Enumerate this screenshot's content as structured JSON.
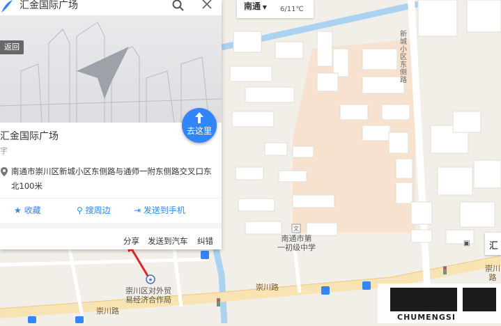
{
  "search": {
    "query": "汇金国际广场"
  },
  "photo": {
    "back_label": "返回"
  },
  "poi": {
    "goto_label": "去这里",
    "name": "汇金国际广场",
    "type": "宇",
    "address_line1": "南通市崇川区新城小区东侧路与通师一附东侧路交叉口东",
    "address_line2": "北100米"
  },
  "actions": [
    {
      "label": "收藏",
      "icon": "star-icon"
    },
    {
      "label": "搜周边",
      "icon": "location-pin-icon"
    },
    {
      "label": "发送到手机",
      "icon": "phone-send-icon"
    }
  ],
  "links": {
    "share": "分享",
    "send_car": "发送到汽车",
    "correct": "纠错"
  },
  "weather": {
    "city": "南通",
    "date": "6/11",
    "unit": "℃"
  },
  "map_labels": {
    "road_left": "崇川区对外贸",
    "road_left2": "易经济合作局",
    "road_main": "崇川路",
    "road_main2": "崇川路",
    "road_right": "崇川路",
    "side_road": "新城小区东侧路",
    "school1": "南通市第",
    "school2": "一初级中学",
    "right_card": "汇"
  },
  "watermark": {
    "text": "CHUMENGSI"
  },
  "colors": {
    "accent": "#3385ff",
    "road": "#f6e3b5",
    "water": "#a9d3f0",
    "block": "#f7d6b8",
    "building": "#ffffff"
  }
}
